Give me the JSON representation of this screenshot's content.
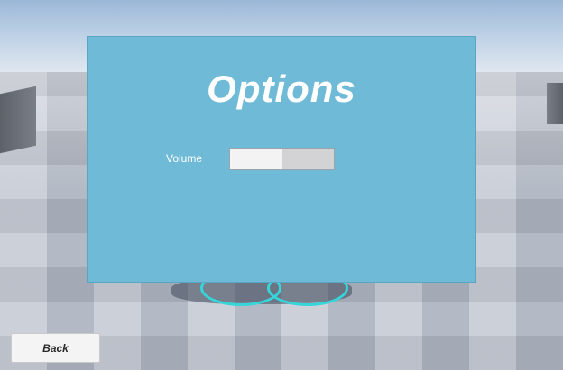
{
  "options_panel": {
    "title": "Options",
    "volume": {
      "label": "Volume",
      "value_fraction": 0.5
    }
  },
  "footer": {
    "back_label": "Back"
  },
  "colors": {
    "panel_background": "#6fbad6",
    "ring_accent": "#35d6d9",
    "button_background": "#f4f4f5"
  }
}
